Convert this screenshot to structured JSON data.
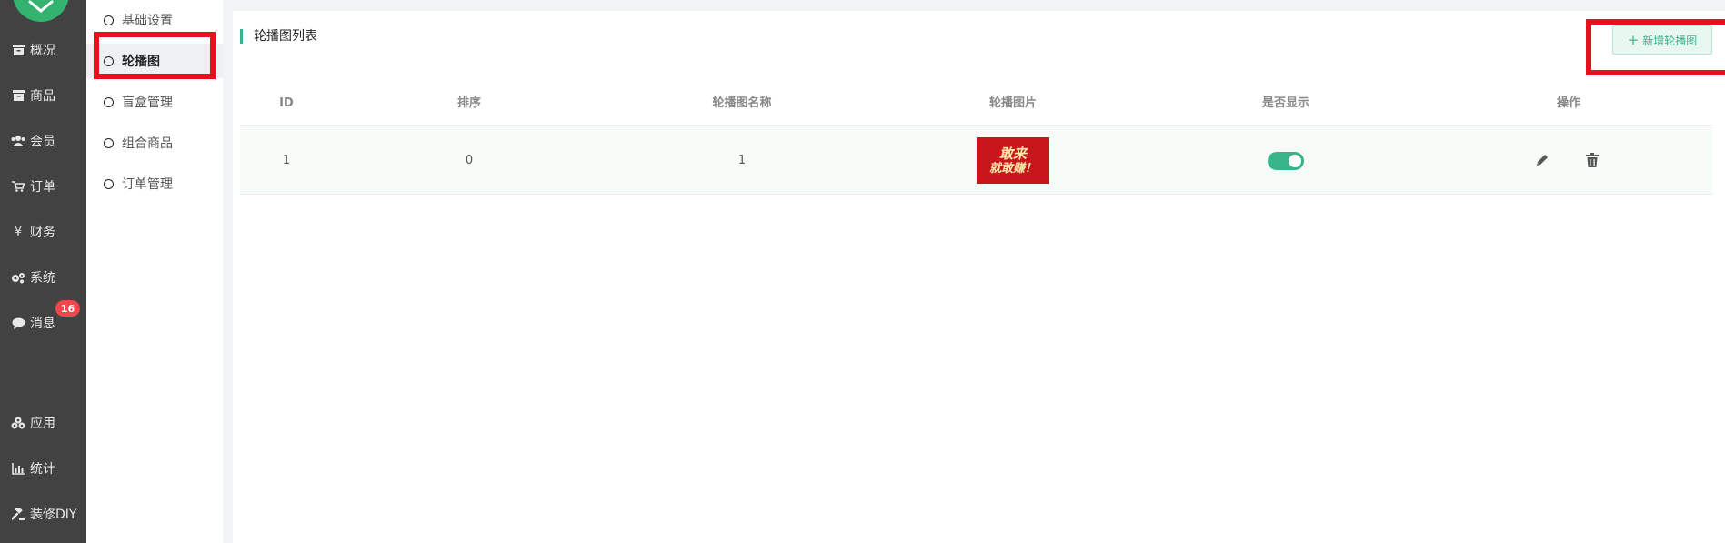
{
  "nav": {
    "items": [
      {
        "label": "概况",
        "icon": "archive-icon"
      },
      {
        "label": "商品",
        "icon": "box-icon"
      },
      {
        "label": "会员",
        "icon": "users-icon"
      },
      {
        "label": "订单",
        "icon": "cart-icon"
      },
      {
        "label": "财务",
        "icon": "yen-icon"
      },
      {
        "label": "系统",
        "icon": "gears-icon"
      },
      {
        "label": "消息",
        "icon": "chat-icon",
        "badge": "16"
      },
      {
        "label": "应用",
        "icon": "cubes-icon"
      },
      {
        "label": "统计",
        "icon": "bar-chart-icon"
      },
      {
        "label": "装修DIY",
        "icon": "gavel-icon"
      }
    ]
  },
  "subnav": {
    "items": [
      {
        "label": "基础设置"
      },
      {
        "label": "轮播图",
        "active": true
      },
      {
        "label": "盲盒管理"
      },
      {
        "label": "组合商品"
      },
      {
        "label": "订单管理"
      }
    ]
  },
  "panel": {
    "title": "轮播图列表",
    "add_button": "新增轮播图",
    "columns": [
      "ID",
      "排序",
      "轮播图名称",
      "轮播图片",
      "是否显示",
      "操作"
    ],
    "rows": [
      {
        "id": "1",
        "sort": "0",
        "name": "1",
        "image_text_1": "敢来",
        "image_text_2": "就敢赚！",
        "visible": true
      }
    ]
  },
  "colors": {
    "accent": "#38b48b",
    "nav_bg": "#424242",
    "badge": "#f0474b",
    "highlight_box": "#e8101e"
  }
}
